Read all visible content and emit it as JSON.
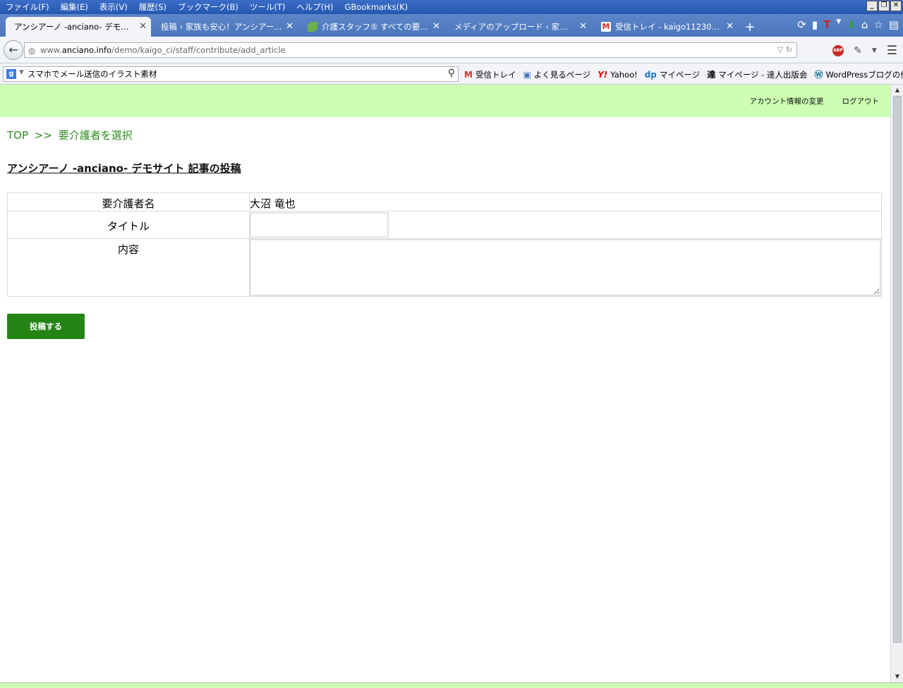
{
  "menubar": {
    "items": [
      "ファイル(F)",
      "編集(E)",
      "表示(V)",
      "履歴(S)",
      "ブックマーク(B)",
      "ツール(T)",
      "ヘルプ(H)",
      "GBookmarks(K)"
    ]
  },
  "tabs": [
    {
      "label": "アンシアーノ -anciano- デモサイト...",
      "active": true,
      "icon": "page-icon",
      "color": "#f2f4f8"
    },
    {
      "label": "投稿 ‹ 家族も安心！アンシアー...",
      "active": false,
      "icon": "none"
    },
    {
      "label": "介護スタッフ⑤ すべての要介...",
      "active": false,
      "icon": "leaf-icon",
      "color": "#6ab04c"
    },
    {
      "label": "メディアのアップロード ‹ 家族も安...",
      "active": false,
      "icon": "none"
    },
    {
      "label": "受信トレイ - kaigo11230808...",
      "active": false,
      "icon": "gmail-icon",
      "color": "#d93025"
    }
  ],
  "navbar": {
    "url_prefix": "www.",
    "url_host": "anciano.info",
    "url_path": "/demo/kaigo_ci/staff/contribute/add_article"
  },
  "search_bar": {
    "value": "スマホでメール送信のイラスト素材"
  },
  "bookmarks": [
    {
      "label": "受信トレイ",
      "icon": "gmail-icon",
      "color": "#d93025"
    },
    {
      "label": "よく見るページ",
      "icon": "folder-icon",
      "color": "#4a76bd"
    },
    {
      "label": "Yahoo!",
      "icon": "yahoo-icon",
      "color": "#e00000"
    },
    {
      "label": "マイページ",
      "icon": "mypage-icon",
      "color": "#1e73be"
    },
    {
      "label": "マイページ - 達人出版会",
      "icon": "tatsujin-icon",
      "color": "#000000"
    },
    {
      "label": "WordPressブログの作成...",
      "icon": "wordpress-icon",
      "color": "#21759b"
    }
  ],
  "header": {
    "account_link": "アカウント情報の変更",
    "logout_link": "ログアウト",
    "background": "#ccffb3"
  },
  "breadcrumb": {
    "top": "TOP",
    "separator": ">>",
    "current": "要介護者を選択",
    "color": "#2e8b1e"
  },
  "page_title": "アンシアーノ -anciano- デモサイト 記事の投稿",
  "form": {
    "care_recipient_label": "要介護者名",
    "care_recipient_value": "大沼 竜也",
    "title_label": "タイトル",
    "title_value": "",
    "content_label": "内容",
    "content_value": "",
    "submit_label": "投稿する",
    "submit_color": "#248514"
  }
}
